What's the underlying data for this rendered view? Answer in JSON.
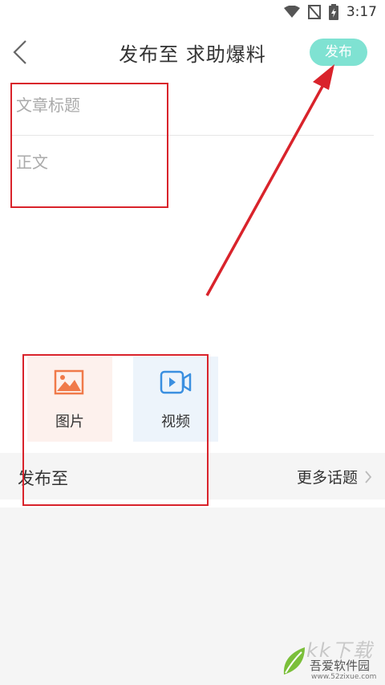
{
  "status_bar": {
    "time": "3:17"
  },
  "header": {
    "title": "发布至  求助爆料",
    "publish_label": "发布"
  },
  "editor": {
    "title_placeholder": "文章标题",
    "body_placeholder": "正文"
  },
  "media": {
    "image_label": "图片",
    "video_label": "视频"
  },
  "topic_row": {
    "label": "发布至",
    "more_label": "更多话题"
  },
  "watermark": {
    "brand": "吾爱软件园",
    "url": "www.52zixue.com",
    "mark": "kk下载"
  },
  "colors": {
    "accent": "#7fe2d2",
    "annotation_red": "#d9232b",
    "image_icon": "#f07a4a",
    "video_icon": "#3a8fe0"
  }
}
